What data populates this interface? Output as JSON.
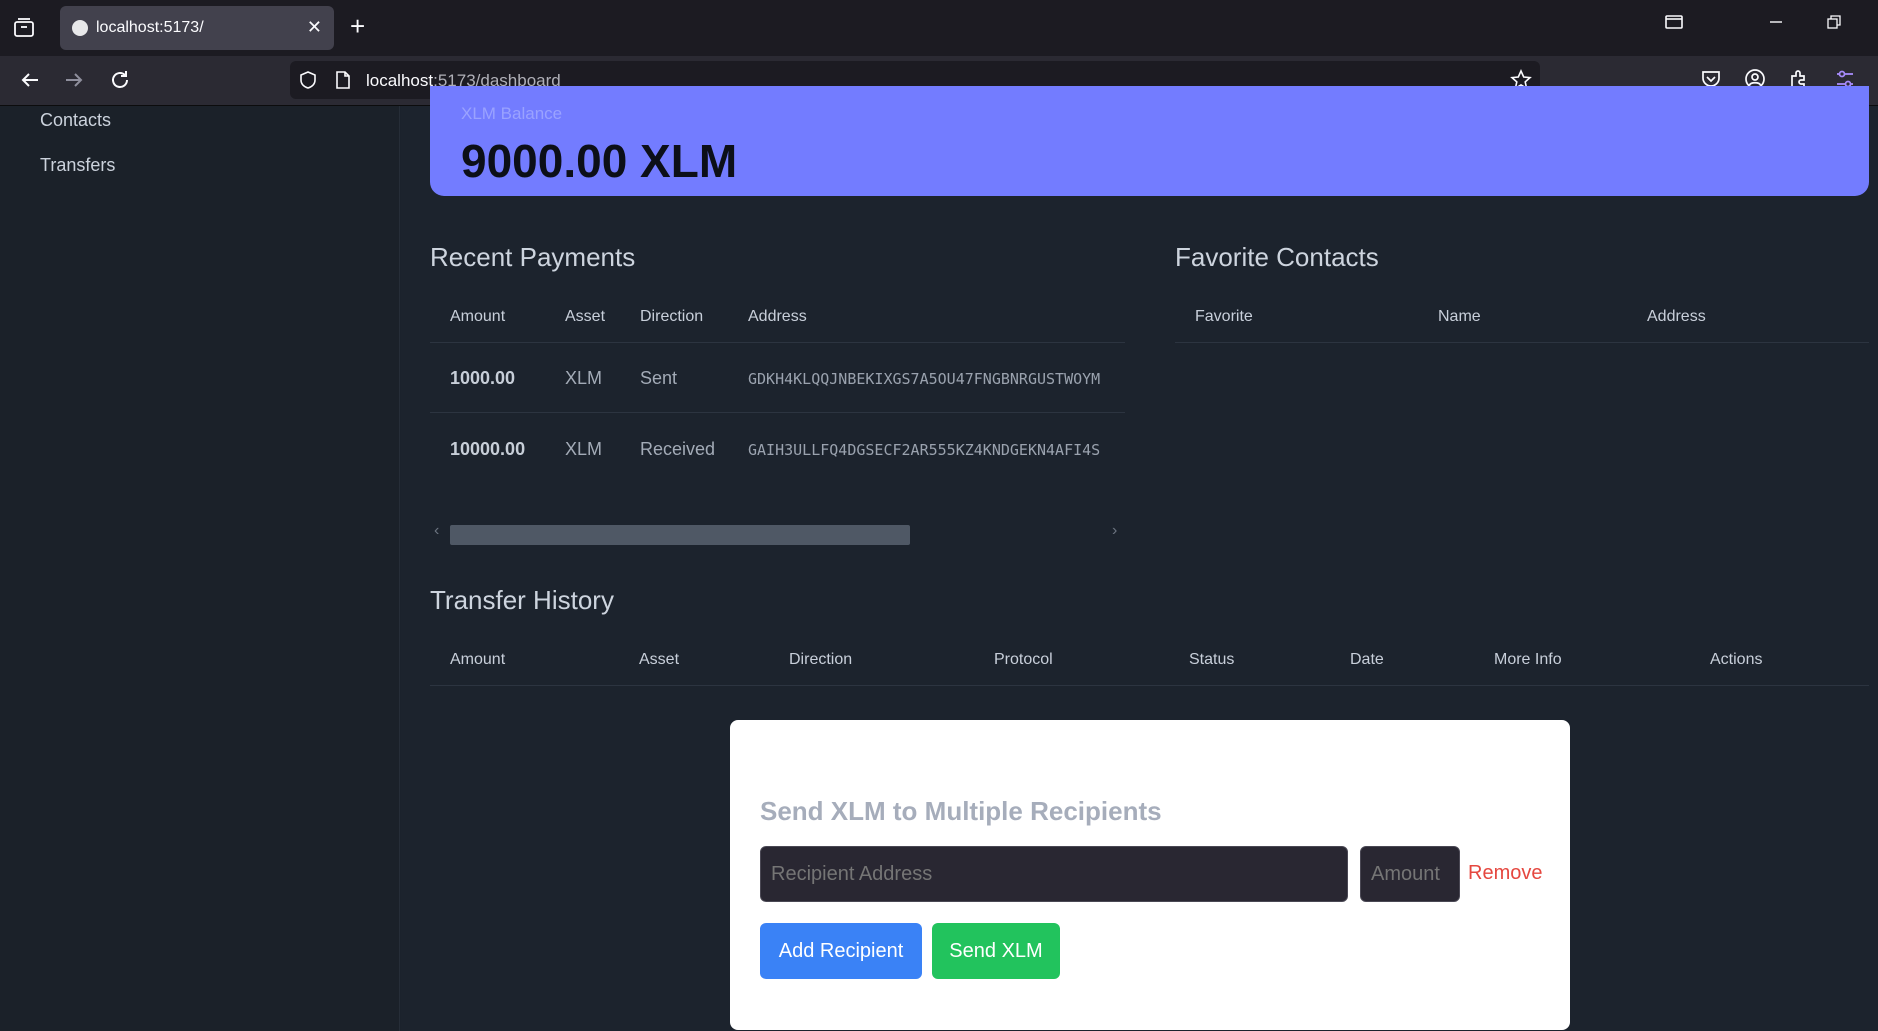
{
  "browser": {
    "tab_title": "localhost:5173/",
    "tab_close": "✕",
    "new_tab": "+",
    "url_host": "localhost",
    "url_rest": ":5173/dashboard"
  },
  "sidebar": {
    "items": [
      {
        "label": "Contacts"
      },
      {
        "label": "Transfers"
      }
    ]
  },
  "balance": {
    "label": "XLM Balance",
    "value": "9000.00 XLM"
  },
  "recent_payments": {
    "title": "Recent Payments",
    "columns": [
      "Amount",
      "Asset",
      "Direction",
      "Address"
    ],
    "rows": [
      {
        "amount": "1000.00",
        "asset": "XLM",
        "direction": "Sent",
        "address": "GDKH4KLQQJNBEKIXGS7A5OU47FNGBNRGUSTWOYM"
      },
      {
        "amount": "10000.00",
        "asset": "XLM",
        "direction": "Received",
        "address": "GAIH3ULLFQ4DGSECF2AR555KZ4KNDGEKN4AFI4S"
      }
    ],
    "scroll_left": "‹",
    "scroll_right": "›"
  },
  "favorite_contacts": {
    "title": "Favorite Contacts",
    "columns": [
      "Favorite",
      "Name",
      "Address"
    ]
  },
  "transfer_history": {
    "title": "Transfer History",
    "columns": [
      "Amount",
      "Asset",
      "Direction",
      "Protocol",
      "Status",
      "Date",
      "More Info",
      "Actions"
    ]
  },
  "modal": {
    "title": "Send XLM to Multiple Recipients",
    "recipient_placeholder": "Recipient Address",
    "amount_placeholder": "Amount",
    "remove_label": "Remove",
    "add_button": "Add Recipient",
    "send_button": "Send XLM"
  },
  "colors": {
    "balance_card": "#737cff",
    "add_button": "#3a82f6",
    "send_button": "#22c35d",
    "remove_link": "#e5473f"
  }
}
